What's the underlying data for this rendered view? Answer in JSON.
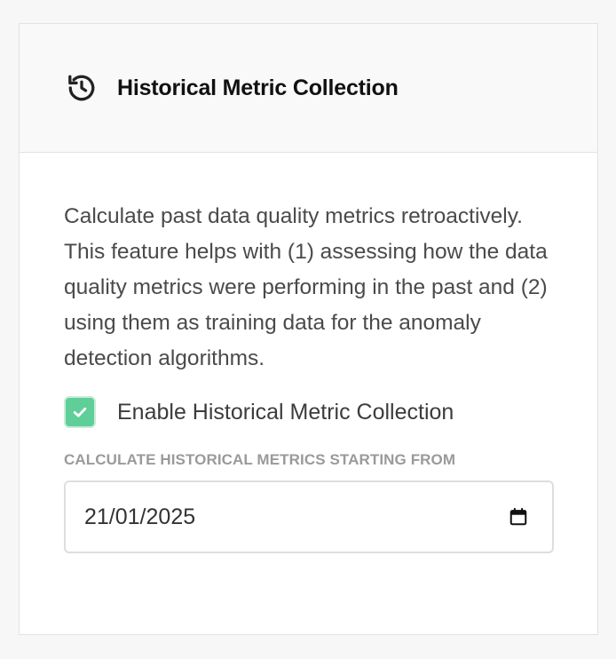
{
  "header": {
    "icon": "history-icon",
    "title": "Historical Metric Collection"
  },
  "body": {
    "description": "Calculate past data quality metrics retroactively. This feature helps with (1) assessing how the data quality metrics were performing in the past and (2) using them as training data for the anomaly detection algorithms.",
    "checkbox": {
      "label": "Enable Historical Metric Collection",
      "checked": true,
      "color": "#5fce98"
    },
    "date_field": {
      "label": "CALCULATE HISTORICAL METRICS STARTING FROM",
      "value": "21/01/2025",
      "icon": "calendar-icon"
    }
  }
}
